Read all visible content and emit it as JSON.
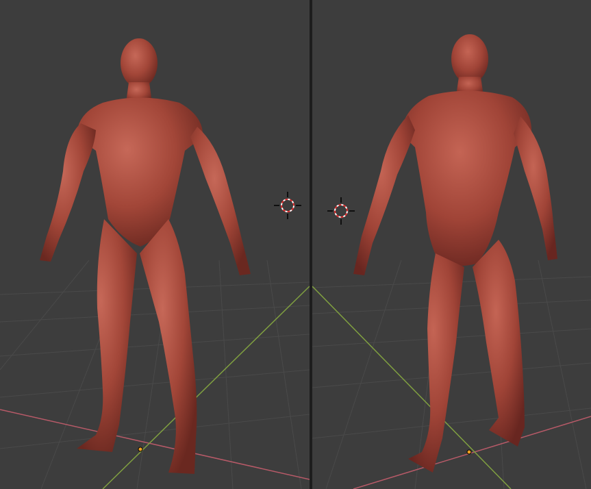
{
  "app": {
    "title": ""
  },
  "viewports": [
    {
      "id": "left",
      "view": "front",
      "object": "sculpted-human-figure",
      "has_3d_cursor": true,
      "has_origin_point": true,
      "axes_visible": [
        "x",
        "y"
      ]
    },
    {
      "id": "right",
      "view": "back",
      "object": "sculpted-human-figure",
      "has_3d_cursor": true,
      "has_origin_point": true,
      "axes_visible": [
        "x",
        "y"
      ]
    }
  ],
  "colors": {
    "background": "#3d3d3d",
    "grid_line": "#4a4a4a",
    "x_axis": "#b85a68",
    "y_axis": "#80a040",
    "origin": "#f0a020",
    "clay": "#a84a3e",
    "clay_highlight": "#c46656",
    "clay_shadow": "#6e2a22",
    "divider": "#1d1d1d"
  },
  "icons": {
    "cursor": "3d-cursor-icon",
    "origin": "origin-point-icon"
  }
}
